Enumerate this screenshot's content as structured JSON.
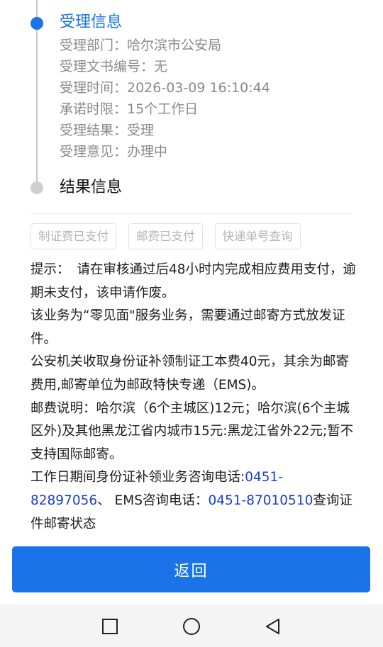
{
  "timeline": {
    "accept_section": {
      "title": "受理信息",
      "rows": [
        "受理部门：哈尔滨市公安局",
        "受理文书编号：无",
        "受理时间：2026-03-09 16:10:44",
        "承诺时限：15个工作日",
        "受理结果：受理",
        "受理意见：办理中"
      ]
    },
    "result_section": {
      "title": "结果信息"
    }
  },
  "status_chips": [
    "制证费已支付",
    "邮费已支付",
    "快递单号查询"
  ],
  "notice": {
    "tip_label": "提示：",
    "tip_text": "请在审核通过后48小时内完成相应费用支付，逾期未支付，该申请作废。",
    "para2": "该业务为“零见面\"服务业务，需要通过邮寄方式放发证件。",
    "para3": "公安机关收取身份证补领制证工本费40元，其余为邮寄费用,邮寄单位为邮政特快专递（EMS)。",
    "para4": "邮费说明：哈尔滨（6个主城区)12元；哈尔滨(6个主城区外)及其他黑龙江省内城市15元:黑龙江省外22元;暂不支持国际邮寄。",
    "contact_prefix": "工作日期间身份证补领业务咨询电话:",
    "contact_phone1": "0451-82897056",
    "contact_mid": "、 EMS咨询电话：",
    "contact_phone2": "0451-87010510",
    "contact_suffix": "查询证件邮寄状态"
  },
  "back_button_label": "返回",
  "colors": {
    "accent": "#1a73e8",
    "phone_link": "#1a3fd6",
    "muted_text": "#8a8a8a"
  },
  "system_nav": {
    "icons": [
      "square-recent-apps-icon",
      "circle-home-icon",
      "triangle-back-icon"
    ]
  }
}
